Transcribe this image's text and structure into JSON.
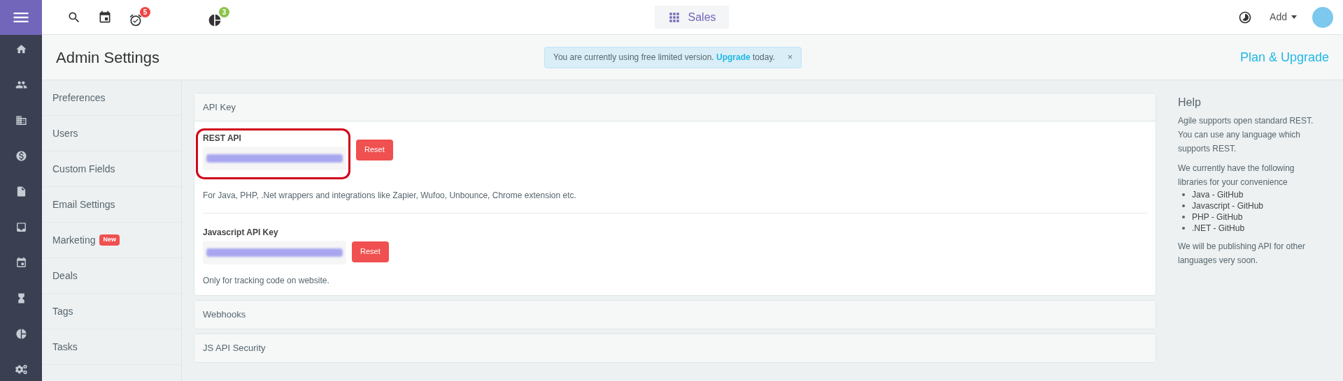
{
  "topbar": {
    "notifications": [
      {
        "kind": "search"
      },
      {
        "kind": "calendar"
      },
      {
        "kind": "alarm",
        "badge": "5",
        "color": "#ef4444"
      },
      {
        "kind": "pie",
        "badge": "3",
        "color": "#8bc34a"
      }
    ],
    "app_switch": "Sales",
    "add_button": "Add"
  },
  "rail": [
    {
      "kind": "home"
    },
    {
      "kind": "people"
    },
    {
      "kind": "building"
    },
    {
      "kind": "dollar"
    },
    {
      "kind": "file"
    },
    {
      "kind": "inbox"
    },
    {
      "kind": "calendar"
    },
    {
      "kind": "hourglass"
    },
    {
      "kind": "pie"
    },
    {
      "kind": "gears"
    }
  ],
  "header": {
    "title": "Admin Settings",
    "notice": "You are currently using free limited version. **Upgrade** today.",
    "notice_close": "×",
    "plan_link": "Plan & Upgrade"
  },
  "settings_menu": [
    {
      "label": "Preferences"
    },
    {
      "label": "Users"
    },
    {
      "label": "Custom Fields"
    },
    {
      "label": "Email Settings"
    },
    {
      "label": "Marketing",
      "badge": "New"
    },
    {
      "label": "Deals"
    },
    {
      "label": "Tags"
    },
    {
      "label": "Tasks"
    }
  ],
  "panels": [
    {
      "title": "API Key",
      "expanded": true,
      "sections": [
        {
          "label": "REST API",
          "button": "Reset",
          "highlighted": true,
          "note": "For Java, PHP, .Net wrappers and integrations like Zapier, Wufoo, Unbounce, Chrome extension etc."
        },
        {
          "label": "Javascript API Key",
          "button": "Reset",
          "highlighted": false,
          "note": "Only for tracking code on website."
        }
      ]
    },
    {
      "title": "Webhooks",
      "expanded": false
    },
    {
      "title": "JS API Security",
      "expanded": false
    }
  ],
  "help": {
    "title": "Help",
    "intro": "Agile supports open standard REST. You can use any language which supports REST.",
    "lead": "We currently have the following libraries for your convenience",
    "libraries": [
      "Java - GitHub",
      "Javascript - GitHub",
      "PHP - GitHub",
      ".NET - GitHub"
    ],
    "outro": "We will be publishing API for other languages very soon."
  }
}
